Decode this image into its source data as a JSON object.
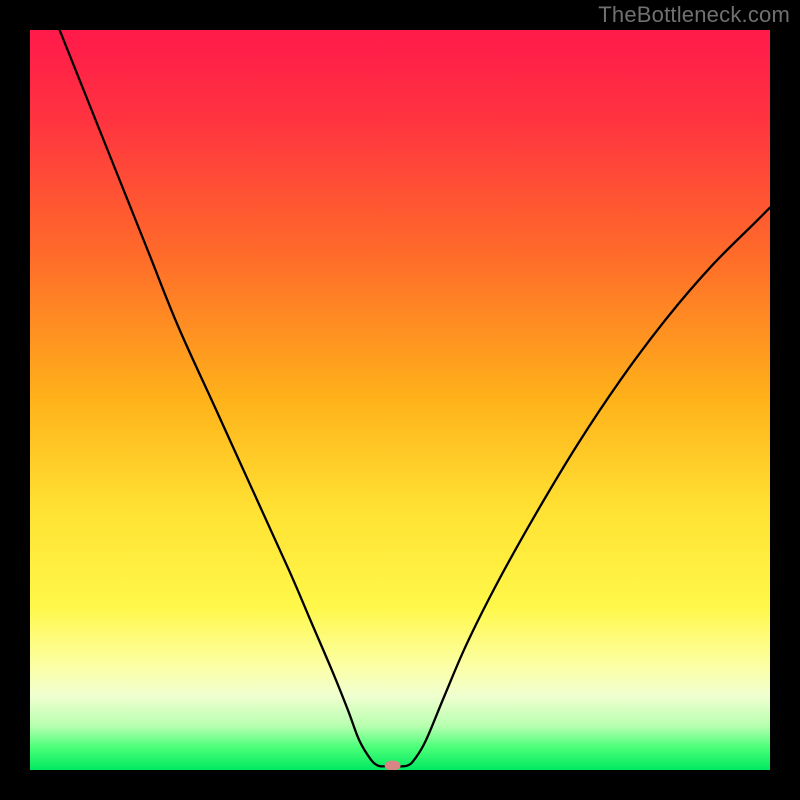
{
  "watermark": "TheBottleneck.com",
  "chart_data": {
    "type": "line",
    "title": "",
    "xlabel": "",
    "ylabel": "",
    "xlim": [
      0,
      100
    ],
    "ylim": [
      0,
      100
    ],
    "grid": false,
    "legend": false,
    "gradient_stops": [
      {
        "pct": 0,
        "color": "#ff1a4a"
      },
      {
        "pct": 12,
        "color": "#ff3340"
      },
      {
        "pct": 30,
        "color": "#ff6a2a"
      },
      {
        "pct": 50,
        "color": "#ffb21a"
      },
      {
        "pct": 65,
        "color": "#ffe233"
      },
      {
        "pct": 78,
        "color": "#fff84a"
      },
      {
        "pct": 86,
        "color": "#fcffa6"
      },
      {
        "pct": 90,
        "color": "#f0ffd0"
      },
      {
        "pct": 94,
        "color": "#b8ffb0"
      },
      {
        "pct": 97,
        "color": "#4aff78"
      },
      {
        "pct": 100,
        "color": "#00e860"
      }
    ],
    "series": [
      {
        "name": "bottleneck-curve",
        "points": [
          {
            "x": 4,
            "y": 100
          },
          {
            "x": 8,
            "y": 90
          },
          {
            "x": 12,
            "y": 80
          },
          {
            "x": 16,
            "y": 70
          },
          {
            "x": 20,
            "y": 60
          },
          {
            "x": 25,
            "y": 49
          },
          {
            "x": 30,
            "y": 38
          },
          {
            "x": 35,
            "y": 27
          },
          {
            "x": 38,
            "y": 20
          },
          {
            "x": 41,
            "y": 13
          },
          {
            "x": 43,
            "y": 8
          },
          {
            "x": 44.5,
            "y": 4
          },
          {
            "x": 46,
            "y": 1.5
          },
          {
            "x": 47,
            "y": 0.6
          },
          {
            "x": 48,
            "y": 0.5
          },
          {
            "x": 49.5,
            "y": 0.5
          },
          {
            "x": 51,
            "y": 0.6
          },
          {
            "x": 52,
            "y": 1.5
          },
          {
            "x": 53.5,
            "y": 4
          },
          {
            "x": 56,
            "y": 10
          },
          {
            "x": 59,
            "y": 17
          },
          {
            "x": 63,
            "y": 25
          },
          {
            "x": 68,
            "y": 34
          },
          {
            "x": 74,
            "y": 44
          },
          {
            "x": 80,
            "y": 53
          },
          {
            "x": 86,
            "y": 61
          },
          {
            "x": 92,
            "y": 68
          },
          {
            "x": 98,
            "y": 74
          },
          {
            "x": 100,
            "y": 76
          }
        ]
      }
    ],
    "marker": {
      "x": 49,
      "y": 0.6,
      "color": "#d88585",
      "rx": 8,
      "ry": 5
    }
  }
}
